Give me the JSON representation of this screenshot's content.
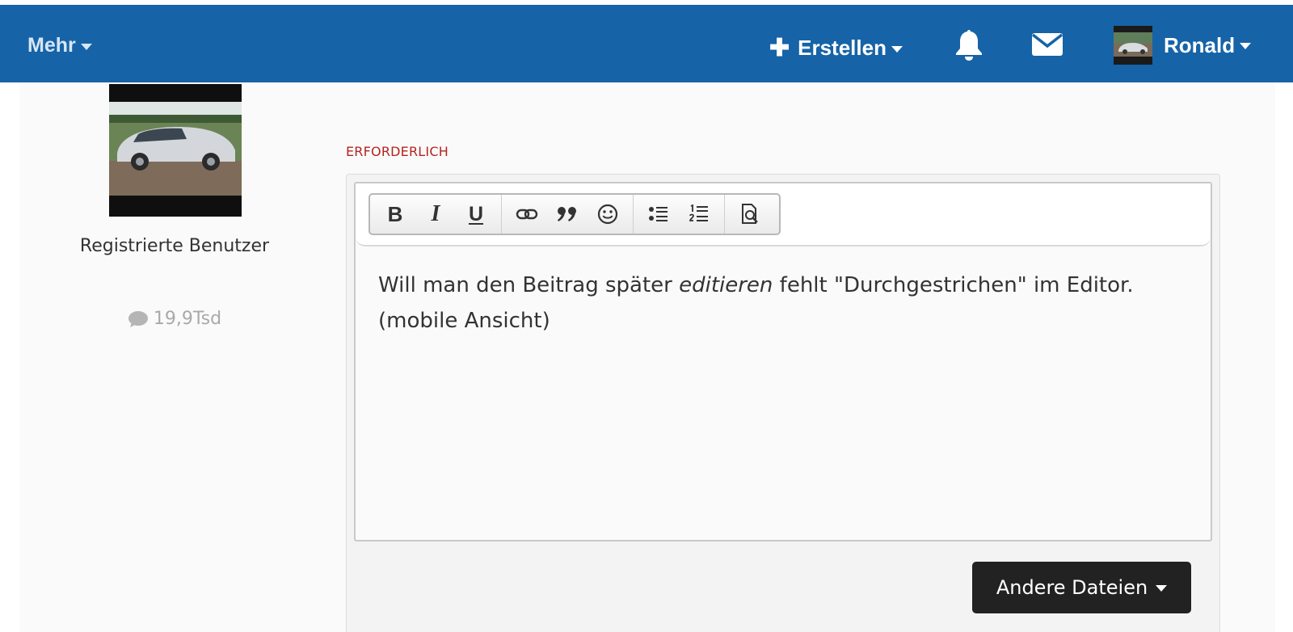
{
  "navbar": {
    "more_label": "Mehr",
    "create_label": "Erstellen",
    "user_name": "Ronald",
    "icons": [
      "plus-icon",
      "bell-icon",
      "envelope-icon",
      "caret-down-icon"
    ],
    "background_color": "#1663a7"
  },
  "author": {
    "role": "Registrierte Benutzer",
    "post_count": "19,9Tsd"
  },
  "editor": {
    "required_label": "ERFORDERLICH",
    "toolbar": {
      "bold": "B",
      "italic": "I",
      "underline": "U",
      "icons": [
        "link-icon",
        "quote-icon",
        "emoji-icon",
        "bullet-list-icon",
        "numbered-list-icon",
        "preview-icon"
      ]
    },
    "content": {
      "text_before": "Will man den Beitrag später ",
      "text_emphasis": "editieren",
      "text_after": " fehlt \"Durchgestrichen\" im Editor.",
      "line2": "(mobile Ansicht)"
    }
  },
  "attachments": {
    "button_label": "Andere Dateien"
  },
  "colors": {
    "required": "#b3251e",
    "attach_button": "#222222",
    "text": "#333333",
    "muted": "#a9a9a9"
  }
}
